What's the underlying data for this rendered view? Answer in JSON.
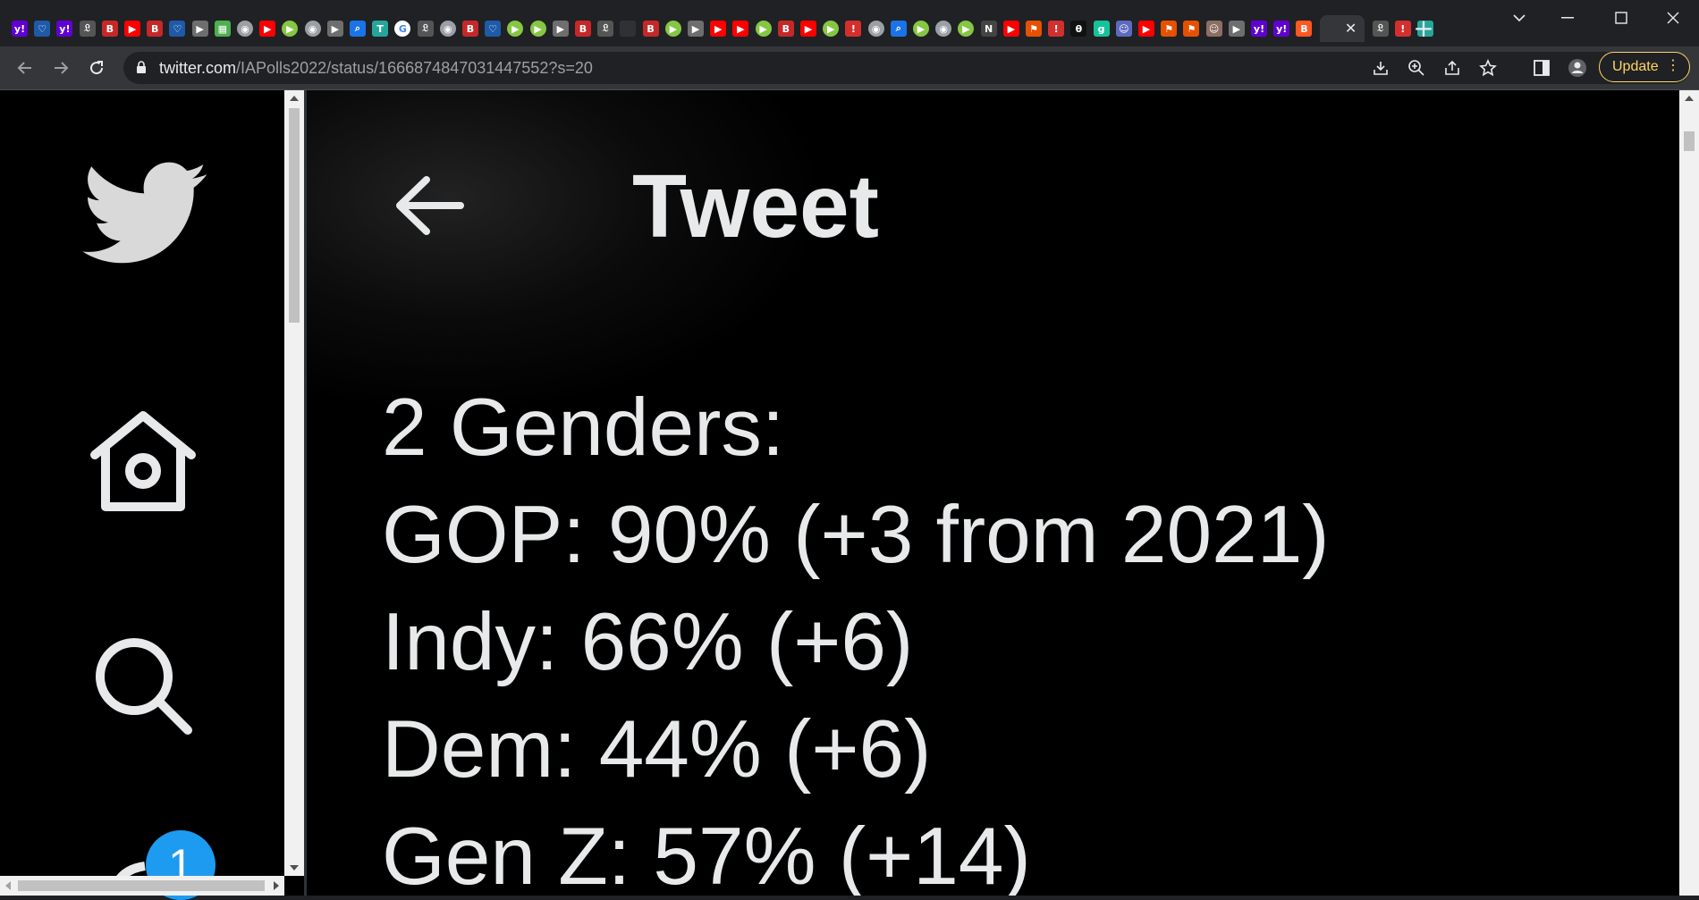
{
  "browser": {
    "tabs": [
      {
        "icon": "yahoo-icon",
        "color": "#6001d2",
        "glyph": "y!"
      },
      {
        "icon": "shield-icon",
        "color": "#1e5aa8",
        "glyph": "♡"
      },
      {
        "icon": "yahoo-icon",
        "color": "#6001d2",
        "glyph": "y!"
      },
      {
        "icon": "newspaper-icon",
        "color": "#555555",
        "glyph": "𝔏"
      },
      {
        "icon": "bi-icon",
        "color": "#c62828",
        "glyph": "B"
      },
      {
        "icon": "youtube-icon",
        "color": "#ff0000",
        "glyph": "▶"
      },
      {
        "icon": "bi-icon",
        "color": "#c62828",
        "glyph": "B"
      },
      {
        "icon": "shield-icon",
        "color": "#1e5aa8",
        "glyph": "♡"
      },
      {
        "icon": "play-icon",
        "color": "#6e6e6e",
        "glyph": "▶"
      },
      {
        "icon": "checker-icon",
        "color": "#4caf50",
        "glyph": "▦"
      },
      {
        "icon": "globe-icon",
        "color": "#9aa0a6",
        "glyph": "◉"
      },
      {
        "icon": "youtube-icon",
        "color": "#ff0000",
        "glyph": "▶"
      },
      {
        "icon": "rumble-icon",
        "color": "#85c742",
        "glyph": "▶"
      },
      {
        "icon": "globe-icon",
        "color": "#9aa0a6",
        "glyph": "◉"
      },
      {
        "icon": "play-icon",
        "color": "#6e6e6e",
        "glyph": "▶"
      },
      {
        "icon": "search-icon",
        "color": "#1a73e8",
        "glyph": "⌕"
      },
      {
        "icon": "tab-icon",
        "color": "#26a69a",
        "glyph": "T"
      },
      {
        "icon": "google-icon",
        "color": "#ffffff",
        "glyph": "G"
      },
      {
        "icon": "newspaper-icon",
        "color": "#555555",
        "glyph": "𝔏"
      },
      {
        "icon": "globe-icon",
        "color": "#9aa0a6",
        "glyph": "◉"
      },
      {
        "icon": "bi-icon",
        "color": "#c62828",
        "glyph": "B"
      },
      {
        "icon": "shield-icon",
        "color": "#1e5aa8",
        "glyph": "♡"
      },
      {
        "icon": "rumble-icon",
        "color": "#85c742",
        "glyph": "▶"
      },
      {
        "icon": "rumble-icon",
        "color": "#85c742",
        "glyph": "▶"
      },
      {
        "icon": "play-icon",
        "color": "#6e6e6e",
        "glyph": "▶"
      },
      {
        "icon": "bi-icon",
        "color": "#c62828",
        "glyph": "B"
      },
      {
        "icon": "newspaper-icon",
        "color": "#555555",
        "glyph": "𝔏"
      },
      {
        "icon": "blank-icon",
        "color": "#303134",
        "glyph": ""
      },
      {
        "icon": "bi-icon",
        "color": "#c62828",
        "glyph": "B"
      },
      {
        "icon": "rumble-icon",
        "color": "#85c742",
        "glyph": "▶"
      },
      {
        "icon": "play-icon",
        "color": "#6e6e6e",
        "glyph": "▶"
      },
      {
        "icon": "youtube-icon",
        "color": "#ff0000",
        "glyph": "▶"
      },
      {
        "icon": "youtube-icon",
        "color": "#ff0000",
        "glyph": "▶"
      },
      {
        "icon": "rumble-icon",
        "color": "#85c742",
        "glyph": "▶"
      },
      {
        "icon": "bi-icon",
        "color": "#c62828",
        "glyph": "B"
      },
      {
        "icon": "youtube-icon",
        "color": "#ff0000",
        "glyph": "▶"
      },
      {
        "icon": "rumble-icon",
        "color": "#85c742",
        "glyph": "▶"
      },
      {
        "icon": "thermometer-icon",
        "color": "#d32f2f",
        "glyph": "!"
      },
      {
        "icon": "globe-icon",
        "color": "#9aa0a6",
        "glyph": "◉"
      },
      {
        "icon": "search-icon",
        "color": "#1a73e8",
        "glyph": "⌕"
      },
      {
        "icon": "rumble-icon",
        "color": "#85c742",
        "glyph": "▶"
      },
      {
        "icon": "globe-icon",
        "color": "#9aa0a6",
        "glyph": "◉"
      },
      {
        "icon": "rumble-icon",
        "color": "#85c742",
        "glyph": "▶"
      },
      {
        "icon": "news-icon",
        "color": "#444444",
        "glyph": "N"
      },
      {
        "icon": "youtube-icon",
        "color": "#ff0000",
        "glyph": "▶"
      },
      {
        "icon": "bookmark-icon",
        "color": "#e65100",
        "glyph": "⚑"
      },
      {
        "icon": "thermometer-icon",
        "color": "#d32f2f",
        "glyph": "!"
      },
      {
        "icon": "theta-icon",
        "color": "#111111",
        "glyph": "θ"
      },
      {
        "icon": "grammarly-icon",
        "color": "#15c39a",
        "glyph": "g"
      },
      {
        "icon": "avatar-icon",
        "color": "#5c6bc0",
        "glyph": "☺"
      },
      {
        "icon": "youtube-icon",
        "color": "#ff0000",
        "glyph": "▶"
      },
      {
        "icon": "bookmark-icon",
        "color": "#e65100",
        "glyph": "⚑"
      },
      {
        "icon": "bookmark-icon",
        "color": "#e65100",
        "glyph": "⚑"
      },
      {
        "icon": "avatar-icon",
        "color": "#8d6e63",
        "glyph": "☺"
      },
      {
        "icon": "play-icon",
        "color": "#6e6e6e",
        "glyph": "▶"
      },
      {
        "icon": "yahoo-icon",
        "color": "#6001d2",
        "glyph": "y!"
      },
      {
        "icon": "yahoo-icon",
        "color": "#6001d2",
        "glyph": "y!"
      },
      {
        "icon": "blogger-icon",
        "color": "#ff5722",
        "glyph": "B"
      }
    ],
    "active_tab": {
      "close_glyph": "✕"
    },
    "after_tabs": [
      {
        "icon": "newspaper-icon",
        "color": "#555555",
        "glyph": "𝔏"
      },
      {
        "icon": "thermometer-icon",
        "color": "#d32f2f",
        "glyph": "!"
      },
      {
        "icon": "bird-icon",
        "color": "#26a69a",
        "glyph": "~"
      }
    ],
    "new_tab_glyph": "+",
    "url_host": "twitter.com",
    "url_path": "/IAPolls2022/status/1666874847031447552?s=20",
    "update_label": "Update",
    "update_dots": "⋮",
    "accent_color": "#fdd663"
  },
  "twitter": {
    "header_title": "Tweet",
    "tweet_lines": [
      "2 Genders:",
      "GOP: 90% (+3 from 2021)",
      "Indy: 66% (+6)",
      "Dem: 44% (+6)",
      "Gen Z: 57% (+14)"
    ],
    "notification_count": "1",
    "badge_color": "#1d9bf0"
  }
}
